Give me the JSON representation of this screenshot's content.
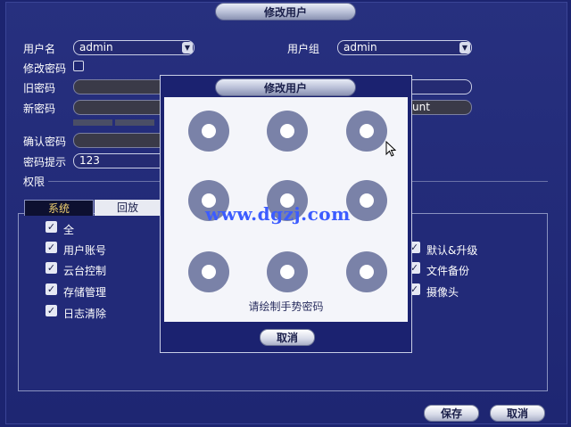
{
  "window": {
    "title": "修改用户"
  },
  "form": {
    "username_label": "用户名",
    "username_value": "admin",
    "usergroup_label": "用户组",
    "usergroup_value": "admin",
    "modify_password_label": "修改密码",
    "old_password_label": "旧密码",
    "new_password_label": "新密码",
    "confirm_password_label": "确认密码",
    "password_hint_label": "密码提示",
    "password_hint_value": "123",
    "permissions_label": "权限",
    "partial_field_text": "unt"
  },
  "tabs": [
    {
      "label": "系统",
      "active": true
    },
    {
      "label": "回放",
      "active": false
    }
  ],
  "permissions_left": [
    {
      "label": "全",
      "checked": true
    },
    {
      "label": "用户账号",
      "checked": true
    },
    {
      "label": "云台控制",
      "checked": true
    },
    {
      "label": "存储管理",
      "checked": true
    },
    {
      "label": "日志清除",
      "checked": true
    }
  ],
  "permissions_right": [
    {
      "label": "默认&升级",
      "checked": true
    },
    {
      "label": "文件备份",
      "checked": true
    },
    {
      "label": "摄像头",
      "checked": true
    }
  ],
  "buttons": {
    "save": "保存",
    "cancel": "取消"
  },
  "gesture_dialog": {
    "title": "修改用户",
    "hint": "请绘制手势密码",
    "cancel": "取消",
    "dot_count": 9
  },
  "watermark": "www.dgzj.com",
  "icons": {
    "dropdown": "chevron-down-icon",
    "check": "checkmark-icon",
    "cursor": "mouse-pointer-icon"
  }
}
